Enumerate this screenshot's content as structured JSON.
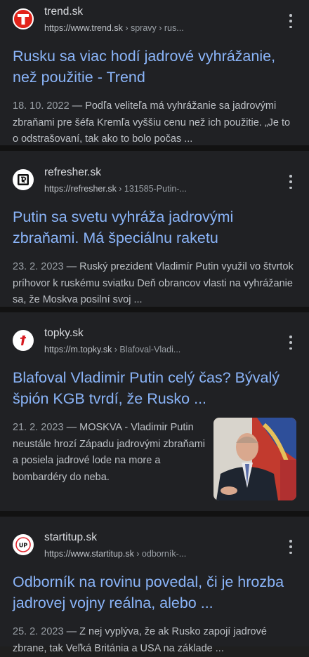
{
  "results": [
    {
      "site": "trend.sk",
      "url": "https://www.trend.sk",
      "crumbs": " › spravy › rus...",
      "title": "Rusku sa viac hodí jadrové vyhrážanie, než použitie - Trend",
      "date": "18. 10. 2022",
      "snippet": " — Podľa veliteľa má vyhrážanie sa jadrovými zbraňami pre šéfa Kremľa vyššiu cenu než ich použitie. „Je to o odstrašovaní, tak ako to bolo počas ...",
      "favicon": "trend-icon"
    },
    {
      "site": "refresher.sk",
      "url": "https://refresher.sk",
      "crumbs": " › 131585-Putin-...",
      "title": "Putin sa svetu vyhráža jadrovými zbraňami. Má špeciálnu raketu",
      "date": "23. 2. 2023",
      "snippet": " — Ruský prezident Vladimír Putin využil vo štvrtok príhovor k ruskému sviatku Deň obrancov vlasti na vyhrážanie sa, že Moskva posilní svoj ...",
      "favicon": "refresher-icon"
    },
    {
      "site": "topky.sk",
      "url": "https://m.topky.sk",
      "crumbs": " › Blafoval-Vladi...",
      "title": "Blafoval Vladimir Putin celý čas? Bývalý špión KGB tvrdí, že Rusko ...",
      "date": "21. 2. 2023",
      "snippet": " — MOSKVA - Vladimir Putin neustále hrozí Západu jadrovými zbraňami a posiela jadrové lode na more a bombardéry do neba.",
      "favicon": "topky-icon"
    },
    {
      "site": "startitup.sk",
      "url": "https://www.startitup.sk",
      "crumbs": " › odborník-...",
      "title": "Odborník na rovinu povedal, či je hrozba jadrovej vojny reálna, alebo ...",
      "date": "25. 2. 2023",
      "snippet": " — Z nej vyplýva, že ak Rusko zapojí jadrové zbrane, tak Veľká Británia a USA na základe ...",
      "favicon": "startitup-icon",
      "favicon_text": "UP"
    }
  ],
  "colors": {
    "title_link": "#8ab4f8",
    "background": "#202124",
    "separator": "#121212",
    "trend_red": "#e2231a",
    "topky_red": "#d71920"
  }
}
